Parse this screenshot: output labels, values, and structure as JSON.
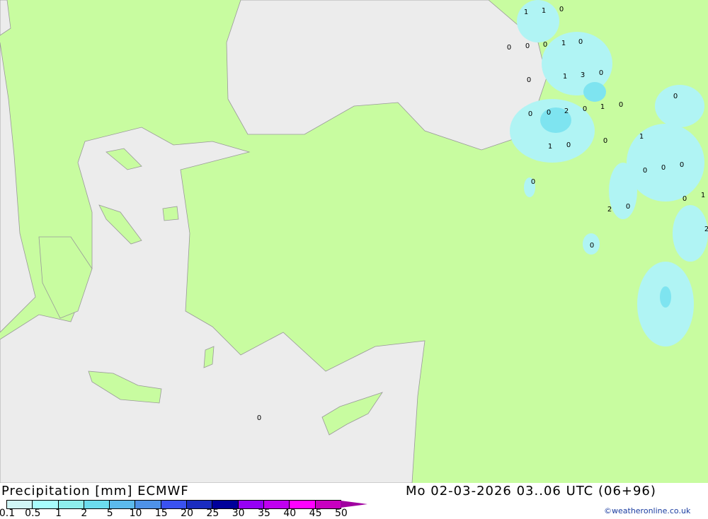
{
  "header": {
    "title": "Precipitation [mm] ECMWF",
    "datetime": "Mo 02-03-2026 03..06 UTC (06+96)",
    "credit": "©weatheronline.co.uk"
  },
  "legend": {
    "ticks": [
      "0.1",
      "0.5",
      "1",
      "2",
      "5",
      "10",
      "15",
      "20",
      "25",
      "30",
      "35",
      "40",
      "45",
      "50"
    ],
    "colors": [
      "#d0f6f6",
      "#a8fcfc",
      "#8eeeec",
      "#6cdcee",
      "#5cbaec",
      "#4e92e8",
      "#3a52f0",
      "#1a2cc0",
      "#00009a",
      "#9600f4",
      "#c000f0",
      "#ff00ff",
      "#c800c0"
    ],
    "arrow_color": "#a000a0"
  },
  "map": {
    "land_color": "#c8fca0",
    "sea_color": "#ececec",
    "precip_light": "#b0f4f4",
    "precip_mid": "#7ee4f0",
    "precip_heavy": "#58c4e8",
    "labels": [
      "1",
      "1",
      "0",
      "0",
      "0",
      "0",
      "1",
      "0",
      "0",
      "1",
      "3",
      "0",
      "0",
      "0",
      "0",
      "2",
      "0",
      "1",
      "0",
      "1",
      "0",
      "0",
      "1",
      "0",
      "0",
      "0",
      "0",
      "0",
      "1",
      "2",
      "0",
      "2",
      "0",
      "0"
    ]
  }
}
